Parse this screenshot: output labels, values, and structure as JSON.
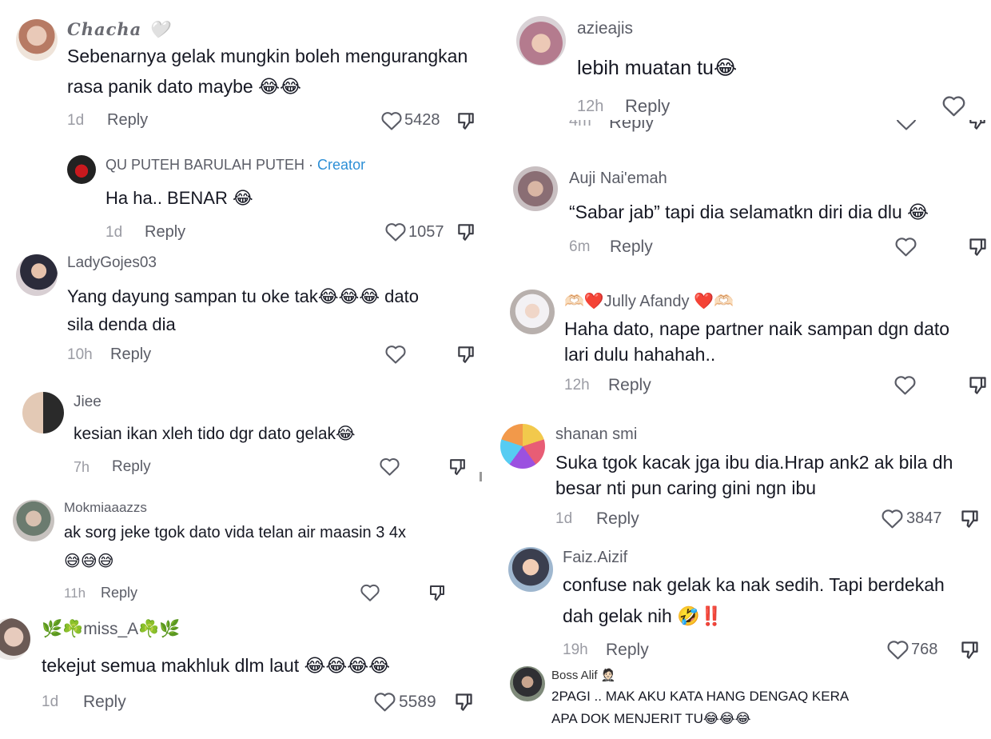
{
  "left": {
    "comments": [
      {
        "user": "Chacha 🤍",
        "text1": "Sebenarnya gelak mungkin boleh mengurangkan",
        "text2": "rasa panik dato maybe 😂😂",
        "time": "1d",
        "reply": "Reply",
        "likes": "5428"
      },
      {
        "user": "QU PUTEH BARULAH PUTEH",
        "creator_sep": " · ",
        "creator": "Creator",
        "text1": "Ha ha.. BENAR 😂",
        "time": "1d",
        "reply": "Reply",
        "likes": "1057"
      },
      {
        "user": "LadyGojes03",
        "text1": "Yang dayung sampan tu oke tak😂😂😂 dato",
        "text2": "sila denda dia",
        "time": "10h",
        "reply": "Reply"
      },
      {
        "user": "Jiee",
        "text1": "kesian ikan xleh tido dgr dato gelak😂",
        "time": "7h",
        "reply": "Reply"
      },
      {
        "user": "Mokmiaaazzs",
        "text1": "ak sorg jeke tgok dato vida telan air maasin 3 4x",
        "text2": "😅😅😅",
        "time": "11h",
        "reply": "Reply"
      },
      {
        "user": "🌿☘️miss_A☘️🌿",
        "text1": "tekejut semua makhluk dlm laut 😂😂😂😂",
        "time": "1d",
        "reply": "Reply",
        "likes": "5589"
      }
    ]
  },
  "right": {
    "comments": [
      {
        "user": "azieajis",
        "text1": "lebih muatan tu😂",
        "time": "12h",
        "reply": "Reply"
      },
      {
        "partial_time": "4m",
        "partial_reply": "Reply"
      },
      {
        "user": "Auji Nai'emah",
        "text1": "“Sabar jab” tapi dia selamatkn diri dia dlu 😂",
        "time": "6m",
        "reply": "Reply"
      },
      {
        "user": "🫶🏻❤️Jully Afandy ❤️🫶🏻",
        "text1": "Haha dato, nape partner naik sampan dgn dato",
        "text2": "lari dulu hahahah..",
        "time": "12h",
        "reply": "Reply"
      },
      {
        "user": "shanan smi",
        "text1": "Suka tgok kacak jga ibu dia.Hrap ank2 ak bila dh",
        "text2": "besar nti pun caring gini ngn ibu",
        "time": "1d",
        "reply": "Reply",
        "likes": "3847"
      },
      {
        "user": "Faiz.Aizif",
        "text1": "confuse nak gelak ka nak sedih. Tapi berdekah",
        "text2": "dah gelak nih 🤣‼️",
        "time": "19h",
        "reply": "Reply",
        "likes": "768"
      },
      {
        "user": "Boss Alif 🤵🏻",
        "text1": "2PAGI .. MAK AKU KATA HANG DENGAQ KERA",
        "text2": "APA DOK MENJERIT TU😂😂😂"
      }
    ]
  },
  "icons": {
    "heart": "heart-icon",
    "dislike": "thumbs-down-icon"
  },
  "colors": {
    "text": "#161823",
    "muted": "#9a9ba3",
    "username": "#5a5c66",
    "creator": "#2d8fd6"
  }
}
